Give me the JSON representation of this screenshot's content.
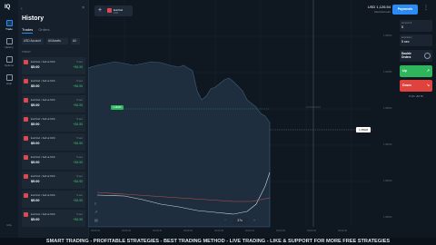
{
  "app": {
    "logo": "IQ"
  },
  "nav": {
    "items": [
      {
        "label": "Trade",
        "icon": "trade-icon",
        "active": true
      },
      {
        "label": "History",
        "icon": "history-icon",
        "active": false
      },
      {
        "label": "Options",
        "icon": "options-icon",
        "active": false
      },
      {
        "label": "Help",
        "icon": "help-icon",
        "active": false
      }
    ],
    "bottom_label": "Info"
  },
  "history_panel": {
    "title": "History",
    "tabs": [
      {
        "label": "Trades",
        "active": true
      },
      {
        "label": "Orders",
        "active": false
      }
    ],
    "filters": {
      "account": "USD Account",
      "assets": "All Assets",
      "period": "All"
    },
    "section_label": "TODAY",
    "trades": [
      {
        "name": "Eur/Usd • Sell at 91%",
        "amount": "$5.00",
        "time": "5 sec",
        "profit": "+$4.55"
      },
      {
        "name": "Eur/Usd • Sell at 91%",
        "amount": "$5.00",
        "time": "5 sec",
        "profit": "+$4.55"
      },
      {
        "name": "Eur/Usd • Sell at 91%",
        "amount": "$5.00",
        "time": "5 sec",
        "profit": "+$4.55"
      },
      {
        "name": "Eur/Usd • Sell at 91%",
        "amount": "$5.00",
        "time": "5 sec",
        "profit": "+$4.55"
      },
      {
        "name": "Eur/Usd • Sell at 91%",
        "amount": "$5.00",
        "time": "5 sec",
        "profit": "+$4.55"
      },
      {
        "name": "Eur/Usd • Sell at 91%",
        "amount": "$5.00",
        "time": "5 sec",
        "profit": "+$4.55"
      },
      {
        "name": "Eur/Usd • Sell at 91%",
        "amount": "$5.00",
        "time": "5 sec",
        "profit": "+$4.55"
      },
      {
        "name": "Eur/Usd • Sell at 91%",
        "amount": "$5.00",
        "time": "5 sec",
        "profit": "+$4.55"
      },
      {
        "name": "Eur/Usd • Sell at 91%",
        "amount": "$5.00",
        "time": "5 sec",
        "profit": "+$4.55"
      }
    ]
  },
  "top": {
    "add_label": "+",
    "asset": {
      "name": "Eur/Usd",
      "payout": "91%"
    },
    "balance": {
      "value": "USD 1,126.54",
      "label": "Real Account"
    },
    "payments_label": "Payments",
    "menu_label": "⋮"
  },
  "order_panel": {
    "amount_label": "Amount $",
    "amount_value": "5",
    "expiration_label": "Expiration",
    "expiration_value": "5 sec",
    "double_label": "Double Orders",
    "up_label": "Up",
    "down_label": "Down",
    "profit_label": "Profit +$4.55"
  },
  "chart": {
    "current_price": "1.08328",
    "marker_label": "1.08325",
    "zoom_value": "37s",
    "zoom_minus": "−",
    "zoom_plus": "+",
    "y_ticks": [
      "1.08400",
      "1.08380",
      "1.08360",
      "1.08340",
      "1.08320",
      "1.08300"
    ],
    "x_ticks": [
      "09:08:20",
      "09:08:30",
      "09:08:40",
      "09:08:50",
      "09:09:00",
      "09:09:10",
      "09:09:20",
      "09:09:30",
      "09:09:40"
    ]
  },
  "banner": "SMART TRADING - PROFITABLE STRATEGIES - BEST TRADING METHOD - LIVE TRADING - LIKE & SUPPORT FOR MORE FREE STRATEGIES"
}
